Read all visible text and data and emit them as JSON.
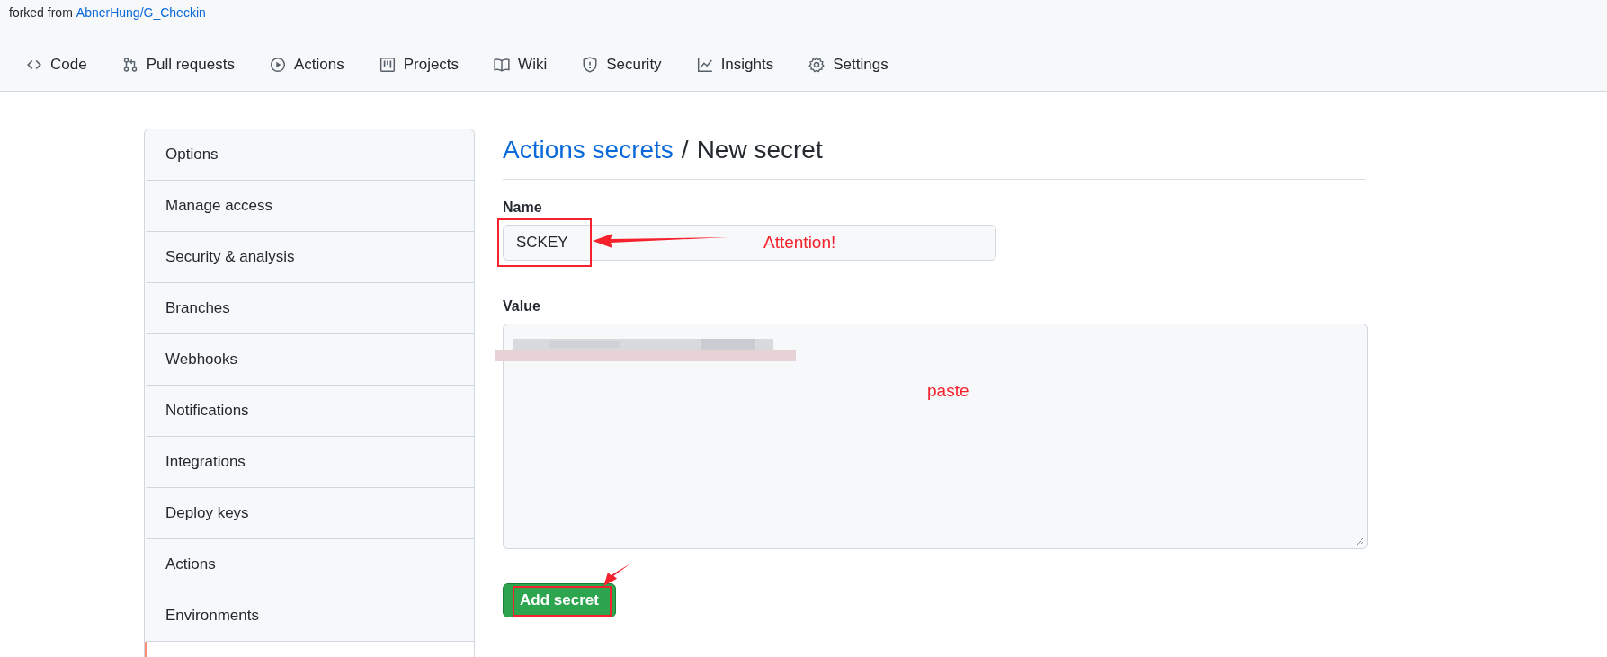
{
  "repo_header": {
    "fork_prefix": "forked from",
    "fork_link": "AbnerHung/G_Checkin"
  },
  "tabs": [
    {
      "label": "Code",
      "selected": false
    },
    {
      "label": "Pull requests",
      "selected": false
    },
    {
      "label": "Actions",
      "selected": false
    },
    {
      "label": "Projects",
      "selected": false
    },
    {
      "label": "Wiki",
      "selected": false
    },
    {
      "label": "Security",
      "selected": false
    },
    {
      "label": "Insights",
      "selected": false
    },
    {
      "label": "Settings",
      "selected": false
    }
  ],
  "sidebar": {
    "items": [
      {
        "label": "Options",
        "selected": false
      },
      {
        "label": "Manage access",
        "selected": false
      },
      {
        "label": "Security & analysis",
        "selected": false
      },
      {
        "label": "Branches",
        "selected": false
      },
      {
        "label": "Webhooks",
        "selected": false
      },
      {
        "label": "Notifications",
        "selected": false
      },
      {
        "label": "Integrations",
        "selected": false
      },
      {
        "label": "Deploy keys",
        "selected": false
      },
      {
        "label": "Actions",
        "selected": false
      },
      {
        "label": "Environments",
        "selected": false
      },
      {
        "selected": true
      }
    ]
  },
  "page_title": {
    "link": "Actions secrets",
    "separator": "/",
    "current": "New secret"
  },
  "form": {
    "name_label": "Name",
    "name_value": "SCKEY",
    "value_label": "Value",
    "value_redacted": true,
    "submit": "Add secret"
  },
  "annotations": [
    {
      "kind": "note",
      "text": "Attention!"
    },
    {
      "kind": "note",
      "text": "paste"
    }
  ]
}
